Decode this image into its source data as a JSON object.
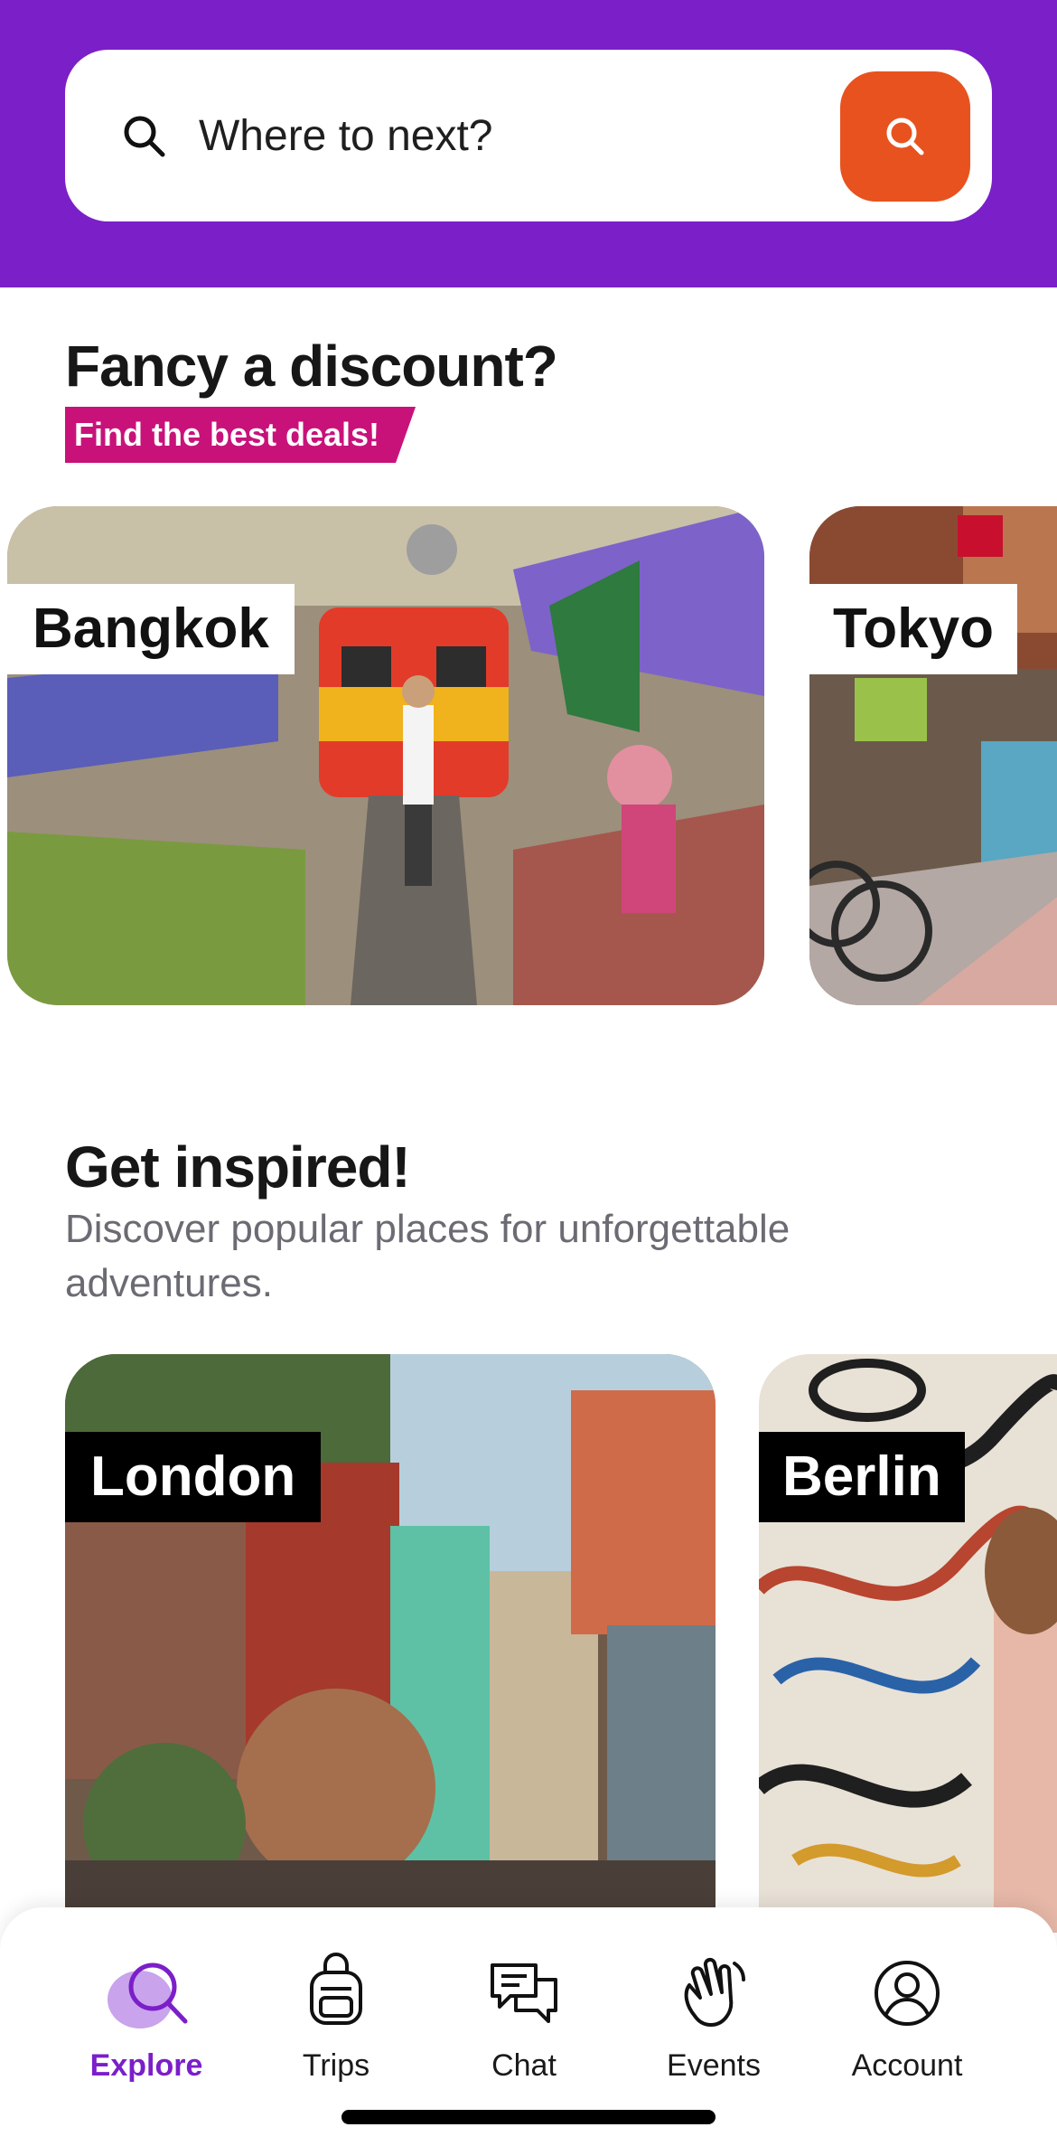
{
  "search": {
    "placeholder": "Where to next?"
  },
  "discount": {
    "title": "Fancy a discount?",
    "badge": "Find the best deals!",
    "cards": [
      {
        "label": "Bangkok"
      },
      {
        "label": "Tokyo"
      }
    ]
  },
  "inspire": {
    "title": "Get inspired!",
    "subtitle": "Discover popular places for unforgettable adventures.",
    "cards": [
      {
        "label": "London"
      },
      {
        "label": "Berlin"
      }
    ]
  },
  "nav": {
    "items": [
      {
        "label": "Explore",
        "icon": "explore-icon",
        "active": true
      },
      {
        "label": "Trips",
        "icon": "backpack-icon",
        "active": false
      },
      {
        "label": "Chat",
        "icon": "chat-icon",
        "active": false
      },
      {
        "label": "Events",
        "icon": "hand-wave-icon",
        "active": false
      },
      {
        "label": "Account",
        "icon": "account-icon",
        "active": false
      }
    ]
  },
  "colors": {
    "brand_purple": "#7b1fc9",
    "search_orange": "#e8521f",
    "badge_magenta": "#c8127a"
  }
}
